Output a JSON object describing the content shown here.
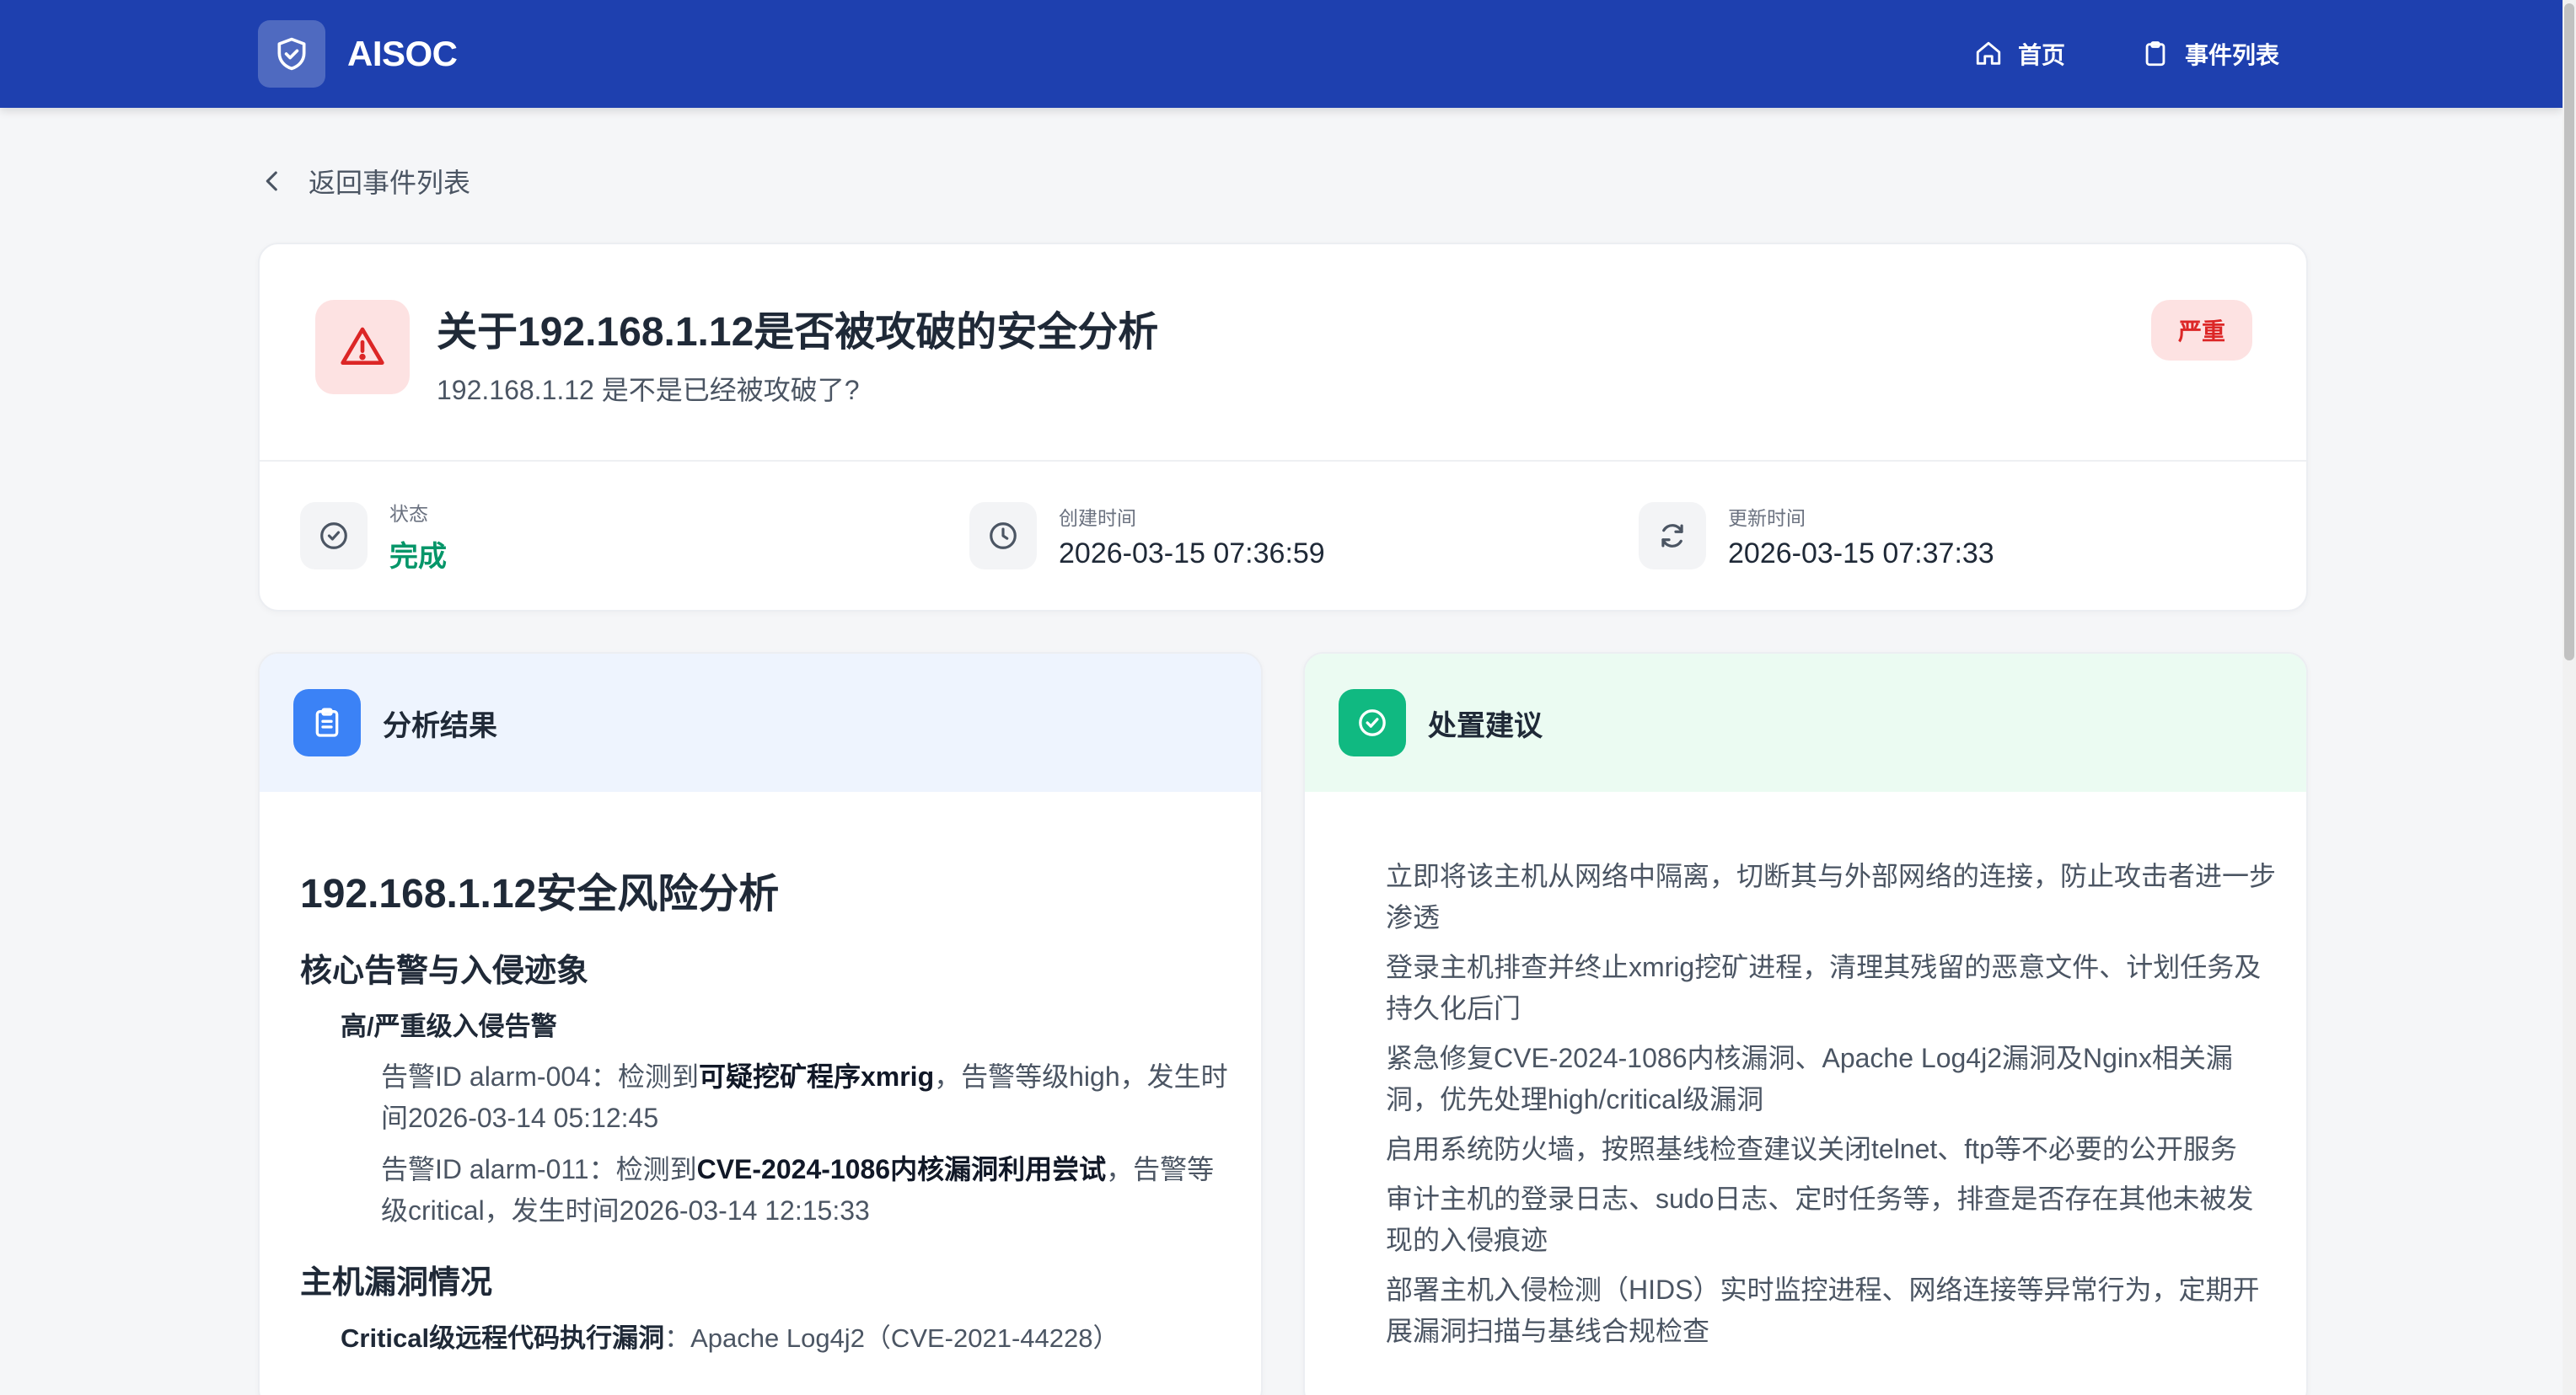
{
  "app": {
    "brand": "AISOC",
    "nav": [
      {
        "label": "首页",
        "icon": "home-icon"
      },
      {
        "label": "事件列表",
        "icon": "clipboard-icon"
      }
    ]
  },
  "back_link": {
    "label": "返回事件列表",
    "icon": "chevron-left-icon"
  },
  "event": {
    "title": "关于192.168.1.12是否被攻破的安全分析",
    "question": "192.168.1.12 是不是已经被攻破了?",
    "severity": "严重",
    "meta": {
      "status_label": "状态",
      "status_value": "完成",
      "created_label": "创建时间",
      "created_value": "2026-03-15 07:36:59",
      "updated_label": "更新时间",
      "updated_value": "2026-03-15 07:37:33"
    }
  },
  "analysis": {
    "panel_title": "分析结果",
    "heading": "192.168.1.12安全风险分析",
    "section1": "核心告警与入侵迹象",
    "subsection1": "高/严重级入侵告警",
    "alerts": [
      {
        "prefix": "告警ID alarm-004：检测到",
        "strong": "可疑挖矿程序xmrig",
        "suffix": "，告警等级high，发生时间2026-03-14 05:12:45"
      },
      {
        "prefix": "告警ID alarm-011：检测到",
        "strong": "CVE-2024-1086内核漏洞利用尝试",
        "suffix": "，告警等级critical，发生时间2026-03-14 12:15:33"
      }
    ],
    "section2": "主机漏洞情况",
    "vuln_strong": "Critical级远程代码执行漏洞",
    "vuln_rest": "：Apache Log4j2（CVE-2021-44228）"
  },
  "recommendations": {
    "panel_title": "处置建议",
    "items": [
      "立即将该主机从网络中隔离，切断其与外部网络的连接，防止攻击者进一步渗透",
      "登录主机排查并终止xmrig挖矿进程，清理其残留的恶意文件、计划任务及持久化后门",
      "紧急修复CVE-2024-1086内核漏洞、Apache Log4j2漏洞及Nginx相关漏洞，优先处理high/critical级漏洞",
      "启用系统防火墙，按照基线检查建议关闭telnet、ftp等不必要的公开服务",
      "审计主机的登录日志、sudo日志、定时任务等，排查是否存在其他未被发现的入侵痕迹",
      "部署主机入侵检测（HIDS）实时监控进程、网络连接等异常行为，定期开展漏洞扫描与基线合规检查"
    ]
  },
  "colors": {
    "topbar": "#1e40af",
    "danger": "#dc2626",
    "success": "#059669",
    "analysis_accent": "#3b82f6",
    "recommend_accent": "#10b981"
  }
}
